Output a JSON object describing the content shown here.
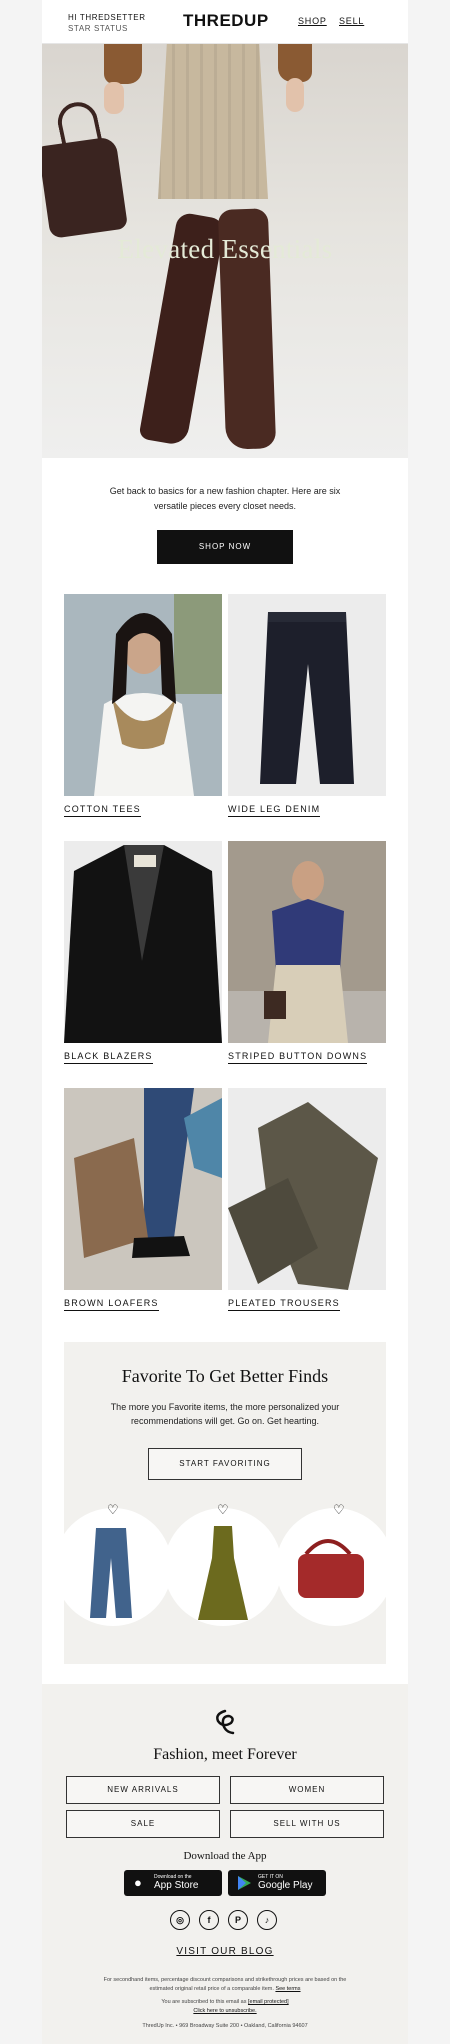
{
  "header": {
    "greeting": "HI THREDSETTER",
    "status": "STAR STATUS",
    "logo": "THREDUP",
    "nav": [
      "SHOP",
      "SELL"
    ]
  },
  "hero": {
    "title": "Elevated Essentials"
  },
  "intro": {
    "text": "Get back to basics for a new fashion chapter. Here are six versatile pieces every closet needs.",
    "cta": "SHOP NOW"
  },
  "products": [
    {
      "label": "COTTON TEES"
    },
    {
      "label": "WIDE LEG DENIM"
    },
    {
      "label": "BLACK BLAZERS"
    },
    {
      "label": "STRIPED BUTTON DOWNS"
    },
    {
      "label": "BROWN LOAFERS"
    },
    {
      "label": "PLEATED TROUSERS"
    }
  ],
  "favorites": {
    "title": "Favorite To Get Better Finds",
    "text": "The more you Favorite items, the more personalized your recommendations will get. Go on. Get hearting.",
    "cta": "START FAVORITING"
  },
  "footer": {
    "title": "Fashion, meet Forever",
    "buttons": [
      "NEW ARRIVALS",
      "WOMEN",
      "SALE",
      "SELL WITH US"
    ],
    "download": "Download the App",
    "appstore_small": "Download on the",
    "appstore": "App Store",
    "googleplay_small": "GET IT ON",
    "googleplay": "Google Play",
    "blog": "VISIT OUR BLOG",
    "disclaimer": "For secondhand items, percentage discount comparisons and strikethrough prices are based on the estimated original retail price of a comparable item.",
    "see_terms": "See terms",
    "subscribed": "You are subscribed to this email as",
    "email": "[email protected]",
    "unsubscribe": "Click here to unsubscribe.",
    "address": "ThredUp Inc. • 969 Broadway Suite 200 • Oakland, California 94607"
  },
  "colors": {
    "primary": "#111111",
    "panel": "#f2f1ee",
    "hero_text": "#e4ead7"
  }
}
